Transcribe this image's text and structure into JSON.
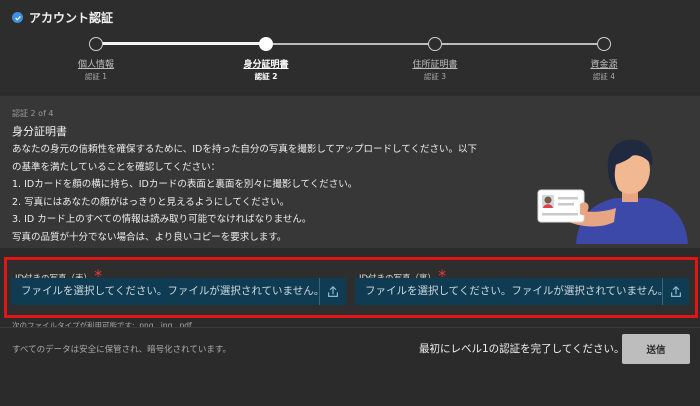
{
  "header": {
    "title": "アカウント認証"
  },
  "steps": [
    {
      "label": "個人情報",
      "sub": "認証 1",
      "active": false
    },
    {
      "label": "身分証明書",
      "sub": "認証 2",
      "active": true
    },
    {
      "label": "住所証明書",
      "sub": "認証 3",
      "active": false
    },
    {
      "label": "資金源",
      "sub": "認証 4",
      "active": false
    }
  ],
  "info": {
    "step_count": "認証 2 of 4",
    "title": "身分証明書",
    "lines": [
      "あなたの身元の信頼性を確保するために、IDを持った自分の写真を撮影してアップロードしてください。以下",
      "の基準を満たしていることを確認してください：",
      "1. IDカードを顔の横に持ち、IDカードの表面と裏面を別々に撮影してください。",
      "2. 写真にはあなたの顔がはっきりと見えるようにしてください。",
      "3. ID カード上のすべての情報は読み取り可能でなければなりません。",
      "写真の品質が十分でない場合は、より良いコピーを要求します。"
    ]
  },
  "upload": {
    "front_label": "ID付きの写真（表）",
    "back_label": "ID付きの写真（裏）",
    "required_mark": "*",
    "placeholder": "ファイルを選択してください。ファイルが選択されていません。",
    "filetypes": "次のファイルタイプが利用可能です: .png, .jpg, .pdf"
  },
  "footer": {
    "note": "すべてのデータは安全に保管され、暗号化されています。",
    "message": "最初にレベル1の認証を完了してください。",
    "submit_label": "送信"
  },
  "colors": {
    "accent": "#3d8fe0",
    "input_bg": "#0f3c52",
    "highlight_border": "#e01515",
    "submit_bg": "#bdbdbd"
  }
}
